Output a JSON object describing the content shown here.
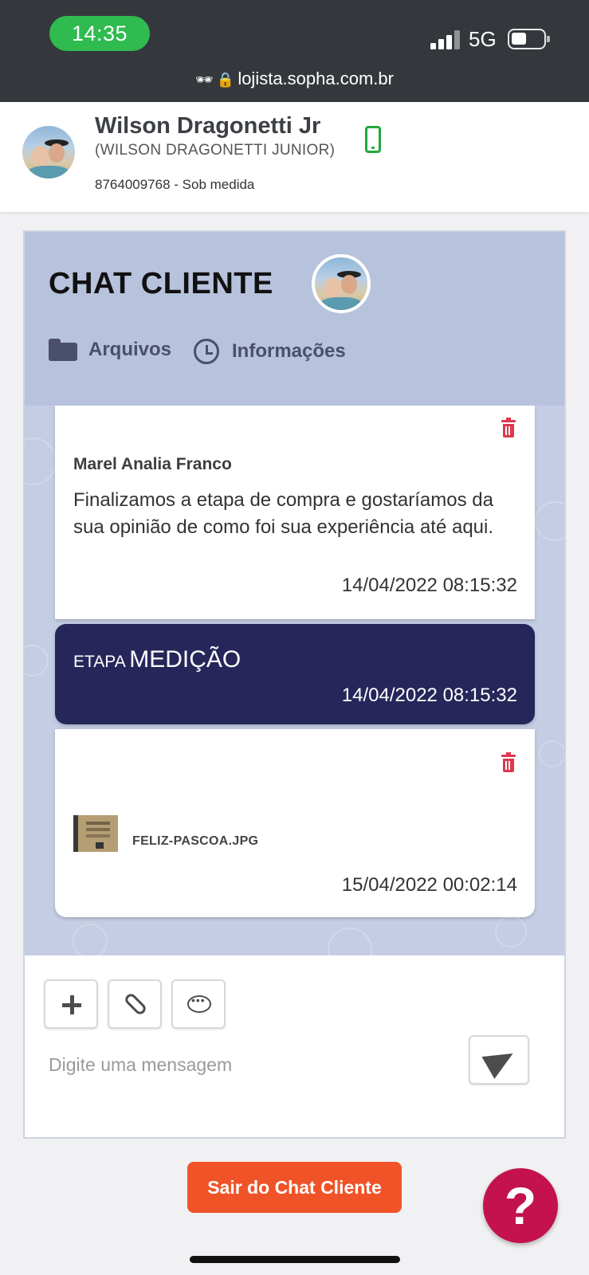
{
  "status_bar": {
    "time": "14:35",
    "network": "5G",
    "url": "lojista.sopha.com.br"
  },
  "customer": {
    "name": "Wilson Dragonetti Jr",
    "legal_name": "(WILSON DRAGONETTI JUNIOR)",
    "code_line": "8764009768 - Sob medida",
    "phone_color": "#22a83a"
  },
  "chat": {
    "title": "CHAT CLIENTE",
    "tabs": [
      {
        "label": "Arquivos",
        "icon": "folder-icon"
      },
      {
        "label": "Informações",
        "icon": "clock-icon"
      }
    ],
    "messages": [
      {
        "author": "Marel Analia Franco",
        "text": "Finalizamos a etapa de compra e gostaríamos da sua opinião de como foi sua experiência até aqui.",
        "time": "14/04/2022 08:15:32"
      },
      {
        "stage_prefix": "ETAPA",
        "stage_name": "MEDIÇÃO",
        "time": "14/04/2022 08:15:32"
      },
      {
        "file_name": "FELIZ-PASCOA.JPG",
        "time": "15/04/2022 00:02:14"
      }
    ],
    "composer": {
      "placeholder": "Digite uma mensagem"
    }
  },
  "footer": {
    "exit_label": "Sair do Chat Cliente",
    "help_label": "?"
  },
  "colors": {
    "status_bar": "#34383c",
    "time_pill": "#2fbb4f",
    "chat_header": "#b7c2dd",
    "stage_bubble": "#27265a",
    "delete": "#e0384f",
    "exit_button": "#ef5327",
    "help_button": "#c3124e"
  }
}
